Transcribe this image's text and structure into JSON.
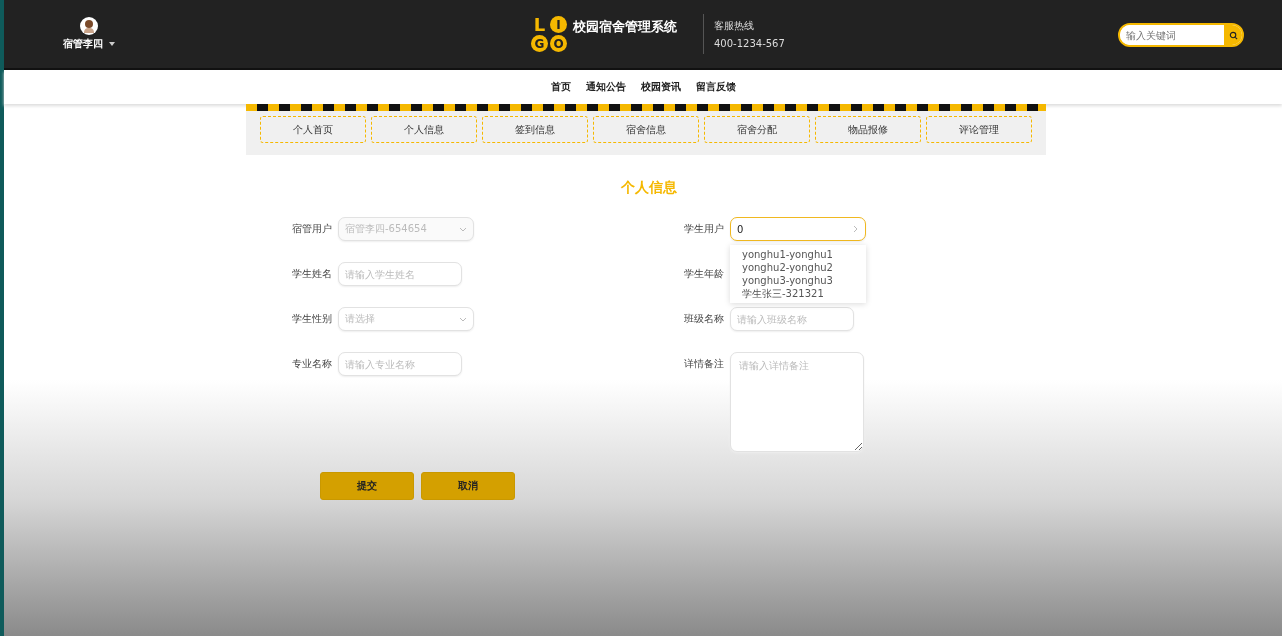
{
  "header": {
    "user_name": "宿管李四",
    "logo_letters": [
      "L",
      "I",
      "G",
      "O"
    ],
    "site_title": "校园宿舍管理系统",
    "hotline_label": "客服热线",
    "hotline_number": "400-1234-567",
    "search": {
      "placeholder": "输入关键词"
    }
  },
  "nav": [
    {
      "label": "首页"
    },
    {
      "label": "通知公告"
    },
    {
      "label": "校园资讯"
    },
    {
      "label": "留言反馈"
    }
  ],
  "tabs": [
    {
      "label": "个人首页",
      "selected": false
    },
    {
      "label": "个人信息",
      "selected": false
    },
    {
      "label": "签到信息",
      "selected": false
    },
    {
      "label": "宿舍信息",
      "selected": false
    },
    {
      "label": "宿舍分配",
      "selected": false
    },
    {
      "label": "物品报修",
      "selected": false
    },
    {
      "label": "评论管理",
      "selected": false
    }
  ],
  "form": {
    "title": "个人信息",
    "left": [
      {
        "label": "宿管用户",
        "kind": "select",
        "placeholder": "宿管李四-654654",
        "disabled": true
      },
      {
        "label": "学生姓名",
        "kind": "input",
        "placeholder": "请输入学生姓名"
      },
      {
        "label": "学生性别",
        "kind": "select",
        "placeholder": "请选择"
      },
      {
        "label": "专业名称",
        "kind": "input",
        "placeholder": "请输入专业名称"
      }
    ],
    "right": [
      {
        "label": "学生用户",
        "kind": "picker",
        "value": "0",
        "focused": true,
        "options": [
          "yonghu1-yonghu1",
          "yonghu2-yonghu2",
          "yonghu3-yonghu3",
          "学生张三-321321"
        ]
      },
      {
        "label": "学生年龄",
        "kind": "hidden"
      },
      {
        "label": "班级名称",
        "kind": "input",
        "placeholder": "请输入班级名称"
      },
      {
        "label": "详情备注",
        "kind": "textarea",
        "placeholder": "请输入详情备注"
      }
    ],
    "buttons": [
      "提交",
      "取消"
    ]
  }
}
